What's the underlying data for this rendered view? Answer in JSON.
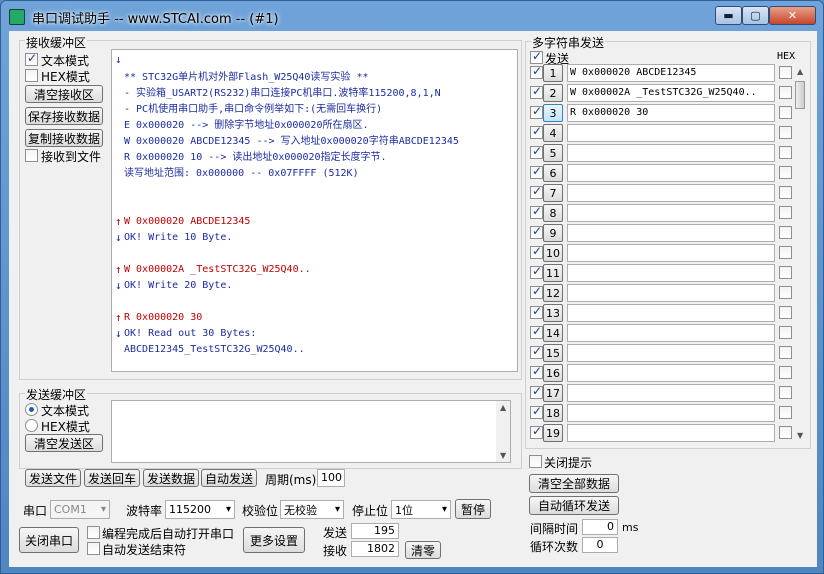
{
  "window": {
    "title": "串口调试助手 -- www.STCAI.com -- (#1)",
    "min": "▬",
    "max": "▢",
    "close": "✕"
  },
  "recv": {
    "group_label": "接收缓冲区",
    "text_mode": "文本模式",
    "hex_mode": "HEX模式",
    "clear": "清空接收区",
    "save": "保存接收数据",
    "copy": "复制接收数据",
    "to_file": "接收到文件",
    "top_arrow": "↓",
    "header_lines": [
      "** STC32G单片机对外部Flash_W25Q40读写实验 **",
      "- 实验箱_USART2(RS232)串口连接PC机串口.波特率115200,8,1,N",
      "- PC机使用串口助手,串口命令例举如下:(无需回车换行)",
      "E 0x000020           --> 删除字节地址0x000020所在扇区.",
      "W 0x000020 ABCDE12345 --> 写入地址0x000020字符串ABCDE12345",
      "R 0x000020 10        --> 读出地址0x000020指定长度字节.",
      "读写地址范围: 0x000000 -- 0x07FFFF  (512K)"
    ],
    "log": [
      {
        "dir": "↑",
        "text": "W 0x000020 ABCDE12345",
        "color": "#c00000"
      },
      {
        "dir": "↓",
        "text": "OK! Write 10 Byte.",
        "color": "#1c2ca0"
      },
      {
        "dir": "↑",
        "text": "W 0x00002A _TestSTC32G_W25Q40..",
        "color": "#c00000"
      },
      {
        "dir": "↓",
        "text": "OK! Write 20 Byte.",
        "color": "#1c2ca0"
      },
      {
        "dir": "↑",
        "text": "R 0x000020 30",
        "color": "#c00000"
      },
      {
        "dir": "↓",
        "text": "OK! Read out  30 Bytes:",
        "color": "#1c2ca0"
      },
      {
        "dir": "",
        "text": "ABCDE12345_TestSTC32G_W25Q40..",
        "color": "#1c2ca0"
      }
    ]
  },
  "send": {
    "group_label": "发送缓冲区",
    "text_mode": "文本模式",
    "hex_mode": "HEX模式",
    "clear": "清空发送区",
    "send_file": "发送文件",
    "send_cr": "发送回车",
    "send_data": "发送数据",
    "auto_send": "自动发送",
    "period_label": "周期(ms)",
    "period_value": "100"
  },
  "port": {
    "port_label": "串口",
    "port_value": "COM1",
    "baud_label": "波特率",
    "baud_value": "115200",
    "parity_label": "校验位",
    "parity_value": "无校验",
    "stop_label": "停止位",
    "stop_value": "1位",
    "pause": "暂停",
    "close_port": "关闭串口",
    "auto_open": "编程完成后自动打开串口",
    "auto_end": "自动发送结束符",
    "more": "更多设置",
    "sent_label": "发送",
    "sent_value": "195",
    "recv_label": "接收",
    "recv_value": "1802",
    "clear_counts": "清零"
  },
  "multi": {
    "group_label": "多字符串发送",
    "send_header": "发送",
    "hex_header": "HEX",
    "rows": [
      {
        "n": "1",
        "text": "W 0x000020 ABCDE12345",
        "checked": true
      },
      {
        "n": "2",
        "text": "W 0x00002A _TestSTC32G_W25Q40..",
        "checked": true
      },
      {
        "n": "3",
        "text": "R 0x000020 30",
        "checked": true
      },
      {
        "n": "4",
        "text": "",
        "checked": true
      },
      {
        "n": "5",
        "text": "",
        "checked": true
      },
      {
        "n": "6",
        "text": "",
        "checked": true
      },
      {
        "n": "7",
        "text": "",
        "checked": true
      },
      {
        "n": "8",
        "text": "",
        "checked": true
      },
      {
        "n": "9",
        "text": "",
        "checked": true
      },
      {
        "n": "10",
        "text": "",
        "checked": true
      },
      {
        "n": "11",
        "text": "",
        "checked": true
      },
      {
        "n": "12",
        "text": "",
        "checked": true
      },
      {
        "n": "13",
        "text": "",
        "checked": true
      },
      {
        "n": "14",
        "text": "",
        "checked": true
      },
      {
        "n": "15",
        "text": "",
        "checked": true
      },
      {
        "n": "16",
        "text": "",
        "checked": true
      },
      {
        "n": "17",
        "text": "",
        "checked": true
      },
      {
        "n": "18",
        "text": "",
        "checked": true
      },
      {
        "n": "19",
        "text": "",
        "checked": true
      }
    ],
    "close_hint": "关闭提示",
    "clear_all": "清空全部数据",
    "auto_loop": "自动循环发送",
    "interval_label": "间隔时间",
    "interval_value": "0",
    "interval_unit": "ms",
    "loop_label": "循环次数",
    "loop_value": "0"
  }
}
